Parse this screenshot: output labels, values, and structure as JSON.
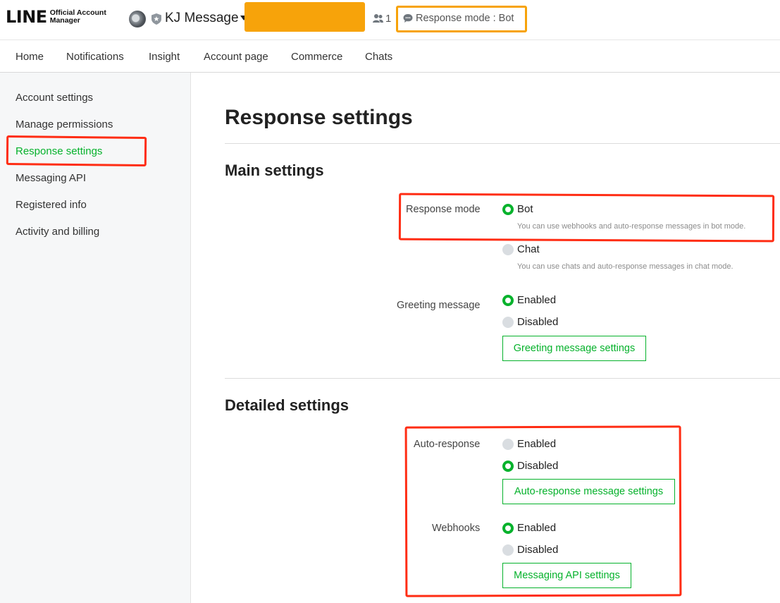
{
  "header": {
    "logo_main": "LINE",
    "logo_sub_1": "Official Account",
    "logo_sub_2": "Manager",
    "account_name": "KJ Message",
    "friends_count": "1",
    "response_mode_text": "Response mode : Bot"
  },
  "topnav": {
    "items": [
      "Home",
      "Notifications",
      "Insight",
      "Account page",
      "Commerce",
      "Chats"
    ]
  },
  "sidebar": {
    "items": [
      "Account settings",
      "Manage permissions",
      "Response settings",
      "Messaging API",
      "Registered info",
      "Activity and billing"
    ],
    "active_index": 2
  },
  "main": {
    "page_title": "Response settings",
    "main_settings": {
      "title": "Main settings",
      "response_mode": {
        "label": "Response mode",
        "options": [
          {
            "label": "Bot",
            "desc": "You can use webhooks and auto-response messages in bot mode.",
            "selected": true
          },
          {
            "label": "Chat",
            "desc": "You can use chats and auto-response messages in chat mode.",
            "selected": false
          }
        ]
      },
      "greeting": {
        "label": "Greeting message",
        "options": [
          {
            "label": "Enabled",
            "selected": true
          },
          {
            "label": "Disabled",
            "selected": false
          }
        ],
        "button": "Greeting message settings"
      }
    },
    "detailed_settings": {
      "title": "Detailed settings",
      "auto_response": {
        "label": "Auto-response",
        "options": [
          {
            "label": "Enabled",
            "selected": false
          },
          {
            "label": "Disabled",
            "selected": true
          }
        ],
        "button": "Auto-response message settings"
      },
      "webhooks": {
        "label": "Webhooks",
        "options": [
          {
            "label": "Enabled",
            "selected": true
          },
          {
            "label": "Disabled",
            "selected": false
          }
        ],
        "button": "Messaging API settings"
      }
    }
  },
  "colors": {
    "accent_green": "#06b22c",
    "annotation_red": "#ff2d14",
    "annotation_orange": "#f7a30a"
  }
}
